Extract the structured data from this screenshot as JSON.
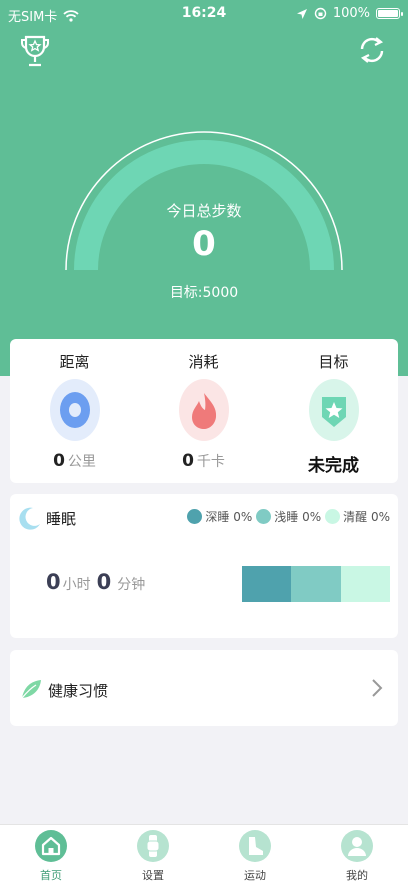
{
  "status_bar": {
    "carrier": "无SIM卡",
    "time": "16:24",
    "battery": "100%"
  },
  "header": {
    "gauge_label": "今日总步数",
    "steps": "0",
    "target": "目标:5000",
    "progress": 0
  },
  "summary": {
    "distance": {
      "title": "距离",
      "value": "0",
      "unit": "公里"
    },
    "calories": {
      "title": "消耗",
      "value": "0",
      "unit": "千卡"
    },
    "goal": {
      "title": "目标",
      "status": "未完成"
    }
  },
  "sleep": {
    "title": "睡眠",
    "legend": [
      {
        "label": "深睡 0%",
        "color": "#4fa2ad"
      },
      {
        "label": "浅睡 0%",
        "color": "#80cbc4"
      },
      {
        "label": "清醒 0%",
        "color": "#c9f7e4"
      }
    ],
    "hours": "0",
    "hours_unit": "小时",
    "minutes": "0",
    "minutes_unit": "分钟"
  },
  "habit": {
    "title": "健康习惯"
  },
  "tabs": [
    {
      "label": "首页",
      "icon": "home-icon",
      "active": true
    },
    {
      "label": "设置",
      "icon": "watch-icon",
      "active": false
    },
    {
      "label": "运动",
      "icon": "shoe-icon",
      "active": false
    },
    {
      "label": "我的",
      "icon": "user-icon",
      "active": false
    }
  ],
  "colors": {
    "brand": "#5fbe96",
    "gauge_track": "#6ed6b4",
    "distance_bg": "#e3ecfb",
    "calories_bg": "#fbe5e5",
    "goal_bg": "#d8f5ea"
  }
}
